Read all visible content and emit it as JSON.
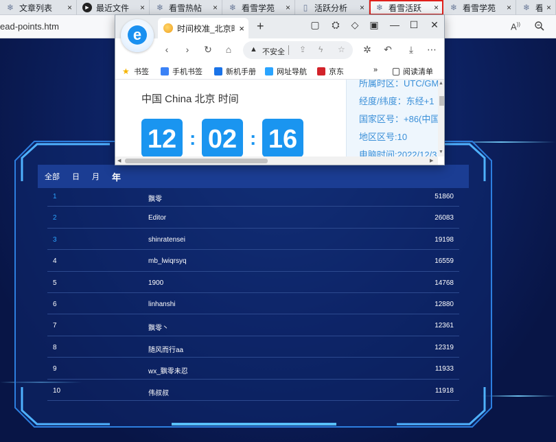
{
  "outer_browser": {
    "tabs": [
      {
        "title": "文章列表",
        "icon": "snowflake-icon",
        "width": 112,
        "active": false
      },
      {
        "title": "最近文件",
        "icon": "play-circle-icon",
        "width": 106,
        "active": false
      },
      {
        "title": "看雪热帖",
        "icon": "snowflake-icon",
        "width": 106,
        "active": false
      },
      {
        "title": "看雪学苑",
        "icon": "snowflake-icon",
        "width": 106,
        "active": false
      },
      {
        "title": "活跃分析",
        "icon": "document-icon",
        "width": 108,
        "active": false
      },
      {
        "title": "看雪活跃",
        "icon": "snowflake-icon",
        "width": 108,
        "active": true
      },
      {
        "title": "看雪学苑",
        "icon": "snowflake-icon",
        "width": 106,
        "active": false
      },
      {
        "title": "看雪",
        "icon": "snowflake-icon",
        "width": 58,
        "active": false
      }
    ],
    "close_glyph": "×",
    "url": "ead-points.htm",
    "read_aloud": "Aͅ",
    "read_aloud_icon": "read-aloud-icon",
    "zoom_icon": "zoom-icon"
  },
  "popup_browser": {
    "tab_title": "时间校准_北京时",
    "tab_close": "×",
    "new_tab": "+",
    "window_buttons": {
      "minimize": "—",
      "maximize": "☐",
      "close": "✕"
    },
    "security_label": "不安全",
    "bookmarks": [
      {
        "label": "书签",
        "icon": "star-icon",
        "color": "#f5b400"
      },
      {
        "label": "手机书签",
        "icon": "phone-bookmark-icon",
        "color": "#3b82f6"
      },
      {
        "label": "新机手册",
        "icon": "manual-icon",
        "color": "#1a73e8"
      },
      {
        "label": "网址导航",
        "icon": "nav-e-icon",
        "color": "#2aa4ff"
      },
      {
        "label": "京东",
        "icon": "jd-icon",
        "color": "#d2232a"
      }
    ],
    "more_bookmarks": "»",
    "reading_list": "阅读清单",
    "content": {
      "city": "中国 China 北京 时间",
      "hours": "12",
      "minutes": "02",
      "seconds": "16",
      "separator": ":",
      "info_lines": [
        "所属时区：UTC/GM",
        "经度/纬度：东经+1",
        "国家区号：+86(中国",
        "地区区号:10",
        "电脑时间:2022/12/3"
      ]
    }
  },
  "ranking": {
    "tabs": [
      {
        "label": "全部",
        "active": false
      },
      {
        "label": "日",
        "active": false
      },
      {
        "label": "月",
        "active": false
      },
      {
        "label": "年",
        "active": true
      }
    ],
    "rows": [
      {
        "rank": "1",
        "name": "飘零",
        "score": "51860"
      },
      {
        "rank": "2",
        "name": "Editor",
        "score": "26083"
      },
      {
        "rank": "3",
        "name": "shinratensei",
        "score": "19198"
      },
      {
        "rank": "4",
        "name": "mb_lwiqrsyq",
        "score": "16559"
      },
      {
        "rank": "5",
        "name": "1900",
        "score": "14768"
      },
      {
        "rank": "6",
        "name": "linhanshi",
        "score": "12880"
      },
      {
        "rank": "7",
        "name": "飘零丶",
        "score": "12361"
      },
      {
        "rank": "8",
        "name": "随风而行aa",
        "score": "12319"
      },
      {
        "rank": "9",
        "name": "wx_飘零未忍",
        "score": "11933"
      },
      {
        "rank": "10",
        "name": "伟叔叔",
        "score": "11918"
      }
    ],
    "highlight_color": "#2aa4ff"
  }
}
